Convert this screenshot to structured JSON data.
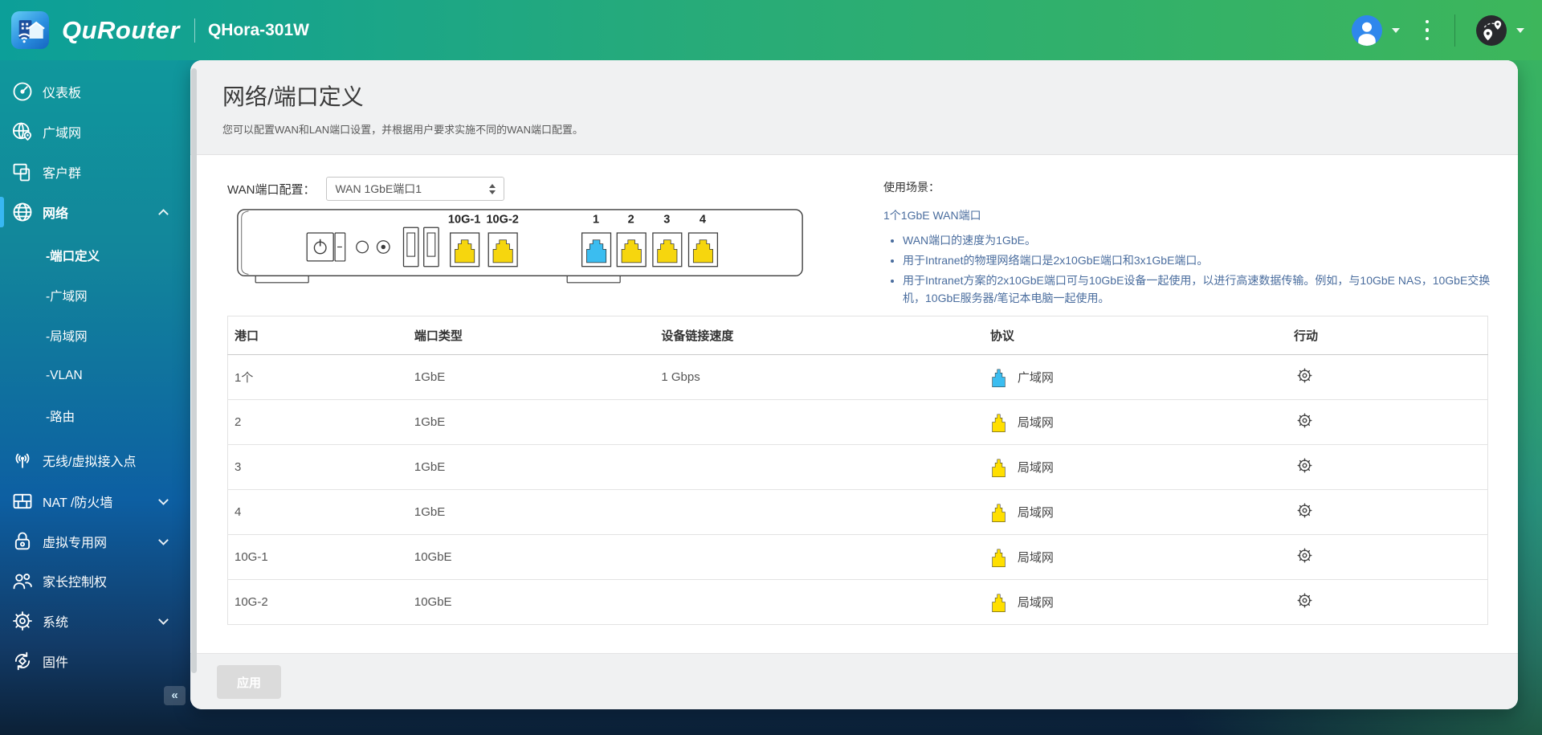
{
  "header": {
    "brand": "QuRouter",
    "model": "QHora-301W"
  },
  "sidebar": {
    "items": [
      {
        "label": "仪表板"
      },
      {
        "label": "广域网"
      },
      {
        "label": "客户群"
      },
      {
        "label": "网络"
      },
      {
        "label": "无线/虚拟接入点"
      },
      {
        "label": "NAT /防火墙"
      },
      {
        "label": "虚拟专用网"
      },
      {
        "label": "家长控制权"
      },
      {
        "label": "系统"
      },
      {
        "label": "固件"
      }
    ],
    "network_children": [
      {
        "label": "-端口定义"
      },
      {
        "label": "-广域网"
      },
      {
        "label": "-局域网"
      },
      {
        "label": "-VLAN"
      },
      {
        "label": "-路由"
      }
    ],
    "collapse_glyph": "«"
  },
  "page": {
    "title": "网络/端口定义",
    "subtitle": "您可以配置WAN和LAN端口设置，并根据用户要求实施不同的WAN端口配置。"
  },
  "config": {
    "label": "WAN端口配置：",
    "value": "WAN 1GbE端口1"
  },
  "diagram": {
    "port_labels": [
      "10G-1",
      "10G-2",
      "1",
      "2",
      "3",
      "4"
    ]
  },
  "usage": {
    "heading": "使用场景：",
    "scenario": "1个1GbE WAN端口",
    "bullets": [
      "WAN端口的速度为1GbE。",
      "用于Intranet的物理网络端口是2x10GbE端口和3x1GbE端口。",
      "用于Intranet方案的2x10GbE端口可与10GbE设备一起使用，以进行高速数据传输。例如，与10GbE NAS，10GbE交换机，10GbE服务器/笔记本电脑一起使用。"
    ]
  },
  "table": {
    "headers": [
      "港口",
      "端口类型",
      "设备链接速度",
      "协议",
      "行动"
    ],
    "rows": [
      {
        "port": "1个",
        "type": "1GbE",
        "speed": "1 Gbps",
        "protocol": "广域网",
        "protocol_color": "#3bbdf0"
      },
      {
        "port": "2",
        "type": "1GbE",
        "speed": "",
        "protocol": "局域网",
        "protocol_color": "#ffdf00"
      },
      {
        "port": "3",
        "type": "1GbE",
        "speed": "",
        "protocol": "局域网",
        "protocol_color": "#ffdf00"
      },
      {
        "port": "4",
        "type": "1GbE",
        "speed": "",
        "protocol": "局域网",
        "protocol_color": "#ffdf00"
      },
      {
        "port": "10G-1",
        "type": "10GbE",
        "speed": "",
        "protocol": "局域网",
        "protocol_color": "#ffdf00"
      },
      {
        "port": "10G-2",
        "type": "10GbE",
        "speed": "",
        "protocol": "局域网",
        "protocol_color": "#ffdf00"
      }
    ]
  },
  "footer": {
    "apply_label": "应用"
  },
  "colors": {
    "wan_port_blue": "#3bbdf0",
    "lan_port_yellow": "#f6d60e",
    "sidebar_active_indicator": "#38b7f2",
    "avatar_blue": "#2f87ec",
    "header_gradient_left": "#0c9f99",
    "header_gradient_right": "#3db65b"
  }
}
